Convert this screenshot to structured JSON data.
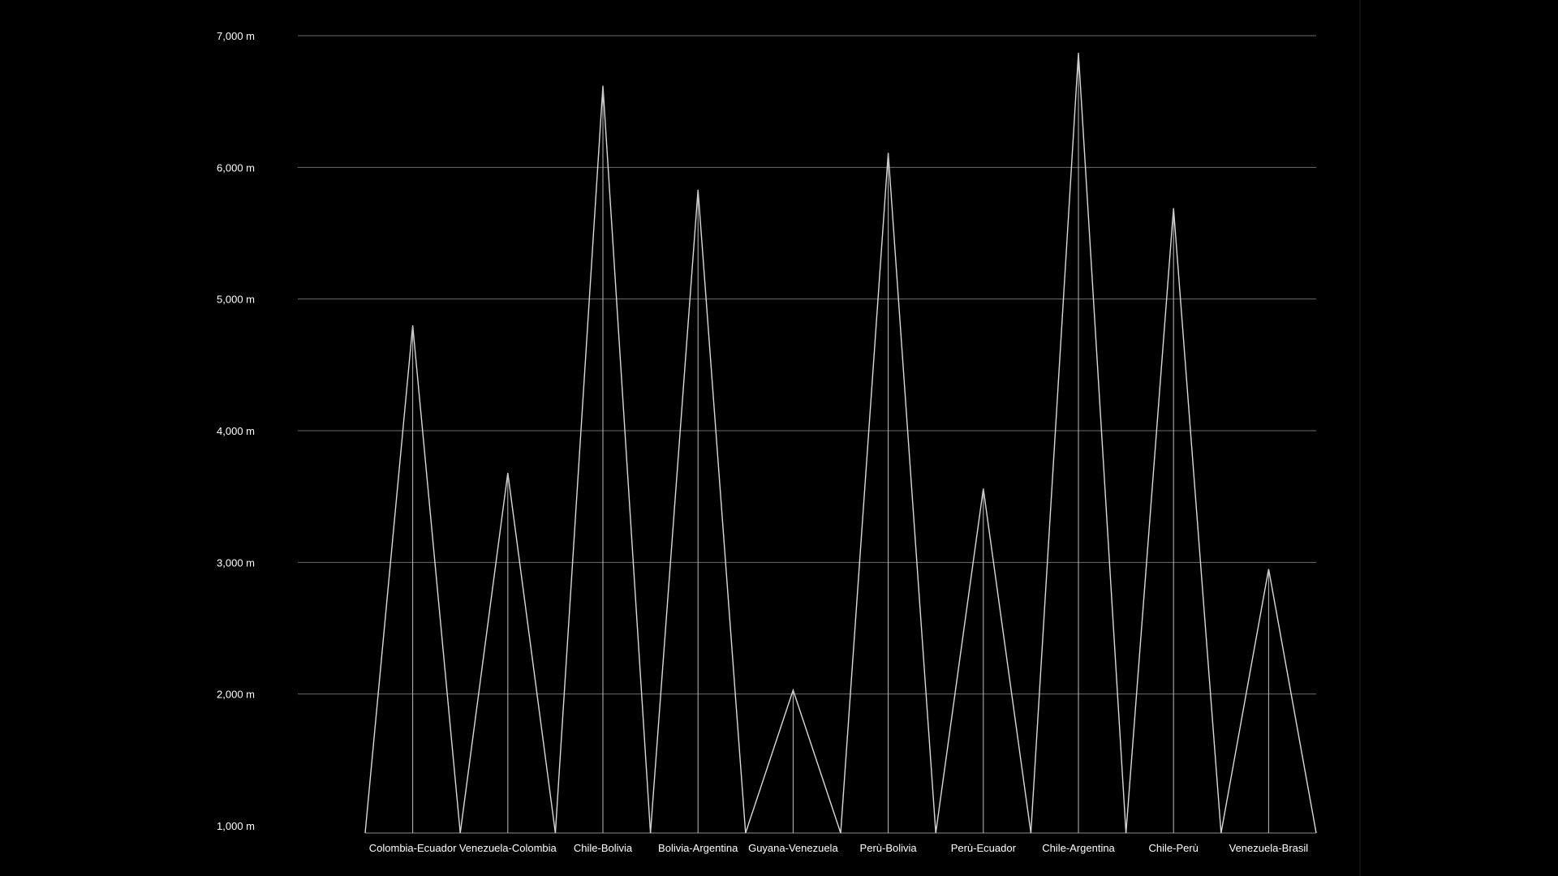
{
  "chart_data": {
    "type": "area",
    "title": "",
    "xlabel": "",
    "ylabel": "",
    "ylim": [
      1000,
      7000
    ],
    "y_ticks": [
      {
        "value": 1000,
        "label": "1,000 m"
      },
      {
        "value": 2000,
        "label": "2,000 m"
      },
      {
        "value": 3000,
        "label": "3,000 m"
      },
      {
        "value": 4000,
        "label": "4,000 m"
      },
      {
        "value": 5000,
        "label": "5,000 m"
      },
      {
        "value": 6000,
        "label": "6,000 m"
      },
      {
        "value": 7000,
        "label": "7,000 m"
      }
    ],
    "grid": true,
    "legend": "none",
    "categories": [
      "Colombia-Ecuador",
      "Venezuela-Colombia",
      "Chile-Bolivia",
      "Bolivia-Argentina",
      "Guyana-Venezuela",
      "Perù-Bolivia",
      "Perù-Ecuador",
      "Chile-Argentina",
      "Chile-Perù",
      "Venezuela-Brasil"
    ],
    "values": [
      4800,
      3680,
      6620,
      5830,
      2030,
      6110,
      3560,
      6870,
      5690,
      2950
    ],
    "colors": {
      "background": "#000000",
      "line": "#d9d9d9",
      "grid": "#6b6b6b",
      "text": "#ffffff"
    }
  }
}
